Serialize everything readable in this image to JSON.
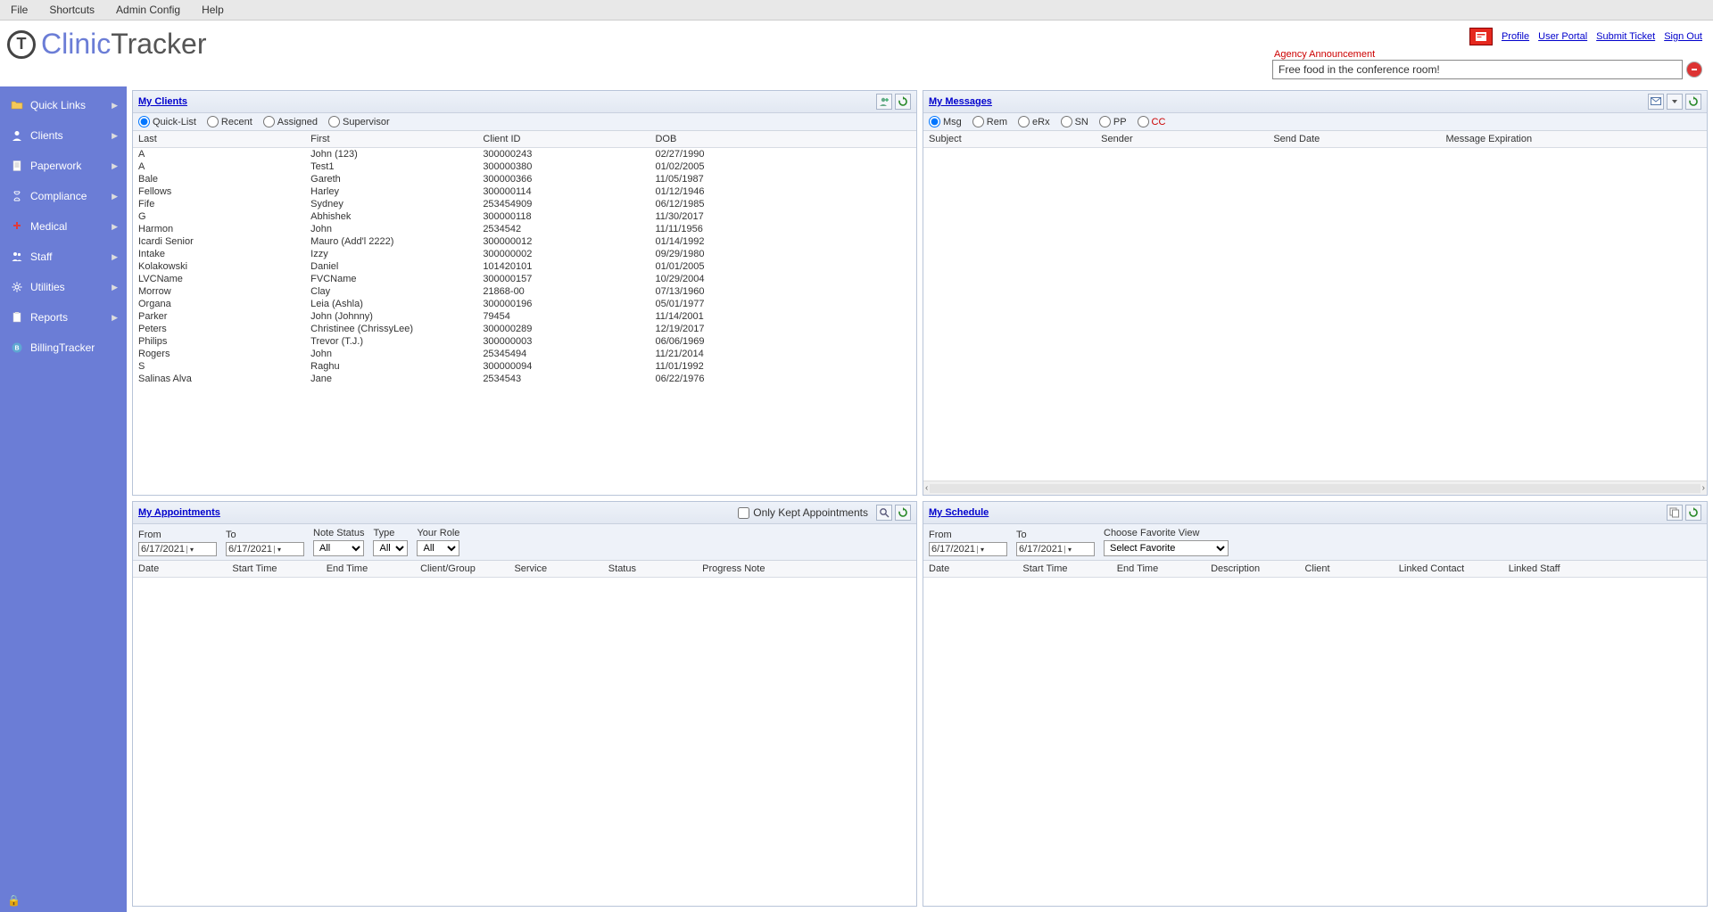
{
  "menubar": {
    "file": "File",
    "shortcuts": "Shortcuts",
    "admin": "Admin Config",
    "help": "Help"
  },
  "logo": {
    "clinic": "Clinic",
    "tracker": "Tracker"
  },
  "header_links": {
    "profile": "Profile",
    "portal": "User Portal",
    "ticket": "Submit Ticket",
    "signout": "Sign Out"
  },
  "announcement": {
    "label": "Agency Announcement",
    "text": "Free food in the conference room!"
  },
  "sidebar": {
    "items": [
      {
        "label": "Quick Links",
        "icon": "folder",
        "arrow": true
      },
      {
        "label": "Clients",
        "icon": "user",
        "arrow": true
      },
      {
        "label": "Paperwork",
        "icon": "doc",
        "arrow": true
      },
      {
        "label": "Compliance",
        "icon": "hourglass",
        "arrow": true
      },
      {
        "label": "Medical",
        "icon": "medical",
        "arrow": true
      },
      {
        "label": "Staff",
        "icon": "staff",
        "arrow": true
      },
      {
        "label": "Utilities",
        "icon": "gear",
        "arrow": true
      },
      {
        "label": "Reports",
        "icon": "clipboard",
        "arrow": true
      },
      {
        "label": "BillingTracker",
        "icon": "billing",
        "arrow": false
      }
    ]
  },
  "clients": {
    "title": "My Clients",
    "radios": {
      "quicklist": "Quick-List",
      "recent": "Recent",
      "assigned": "Assigned",
      "supervisor": "Supervisor"
    },
    "cols": {
      "last": "Last",
      "first": "First",
      "id": "Client ID",
      "dob": "DOB"
    },
    "rows": [
      {
        "last": "A",
        "first": "John  (123)",
        "id": "300000243",
        "dob": "02/27/1990"
      },
      {
        "last": "A",
        "first": "Test1",
        "id": "300000380",
        "dob": "01/02/2005"
      },
      {
        "last": "Bale",
        "first": "Gareth",
        "id": "300000366",
        "dob": "11/05/1987"
      },
      {
        "last": "Fellows",
        "first": "Harley",
        "id": "300000114",
        "dob": "01/12/1946"
      },
      {
        "last": "Fife",
        "first": "Sydney",
        "id": "253454909",
        "dob": "06/12/1985"
      },
      {
        "last": "G",
        "first": "Abhishek",
        "id": "300000118",
        "dob": "11/30/2017"
      },
      {
        "last": "Harmon",
        "first": "John",
        "id": "2534542",
        "dob": "11/11/1956"
      },
      {
        "last": "Icardi Senior",
        "first": "Mauro  (Add'l 2222)",
        "id": "300000012",
        "dob": "01/14/1992"
      },
      {
        "last": "Intake",
        "first": "Izzy",
        "id": "300000002",
        "dob": "09/29/1980"
      },
      {
        "last": "Kolakowski",
        "first": "Daniel",
        "id": "101420101",
        "dob": "01/01/2005"
      },
      {
        "last": "LVCName",
        "first": "FVCName",
        "id": "300000157",
        "dob": "10/29/2004"
      },
      {
        "last": "Morrow",
        "first": "Clay",
        "id": "21868-00",
        "dob": "07/13/1960"
      },
      {
        "last": "Organa",
        "first": "Leia  (Ashla)",
        "id": "300000196",
        "dob": "05/01/1977"
      },
      {
        "last": "Parker",
        "first": "John  (Johnny)",
        "id": "79454",
        "dob": "11/14/2001"
      },
      {
        "last": "Peters",
        "first": "Christinee  (ChrissyLee)",
        "id": "300000289",
        "dob": "12/19/2017"
      },
      {
        "last": "Philips",
        "first": "Trevor  (T.J.)",
        "id": "300000003",
        "dob": "06/06/1969"
      },
      {
        "last": "Rogers",
        "first": "John",
        "id": "25345494",
        "dob": "11/21/2014"
      },
      {
        "last": "S",
        "first": "Raghu",
        "id": "300000094",
        "dob": "11/01/1992"
      },
      {
        "last": "Salinas Alva",
        "first": "Jane",
        "id": "2534543",
        "dob": "06/22/1976"
      }
    ]
  },
  "messages": {
    "title": "My Messages",
    "radios": {
      "msg": "Msg",
      "rem": "Rem",
      "erx": "eRx",
      "sn": "SN",
      "pp": "PP",
      "cc": "CC"
    },
    "cols": {
      "subject": "Subject",
      "sender": "Sender",
      "send_date": "Send Date",
      "exp": "Message Expiration"
    }
  },
  "appointments": {
    "title": "My Appointments",
    "only_kept": "Only Kept Appointments",
    "labels": {
      "from": "From",
      "to": "To",
      "note": "Note Status",
      "type": "Type",
      "role": "Your Role"
    },
    "from": "6/17/2021",
    "to": "6/17/2021",
    "note_status": "All",
    "type": "All",
    "role": "All",
    "cols": {
      "date": "Date",
      "start": "Start Time",
      "end": "End Time",
      "cg": "Client/Group",
      "svc": "Service",
      "status": "Status",
      "pn": "Progress Note"
    }
  },
  "schedule": {
    "title": "My Schedule",
    "labels": {
      "from": "From",
      "to": "To",
      "fav": "Choose Favorite View"
    },
    "from": "6/17/2021",
    "to": "6/17/2021",
    "fav": "Select Favorite",
    "cols": {
      "date": "Date",
      "start": "Start Time",
      "end": "End Time",
      "desc": "Description",
      "client": "Client",
      "lc": "Linked Contact",
      "ls": "Linked Staff"
    }
  }
}
